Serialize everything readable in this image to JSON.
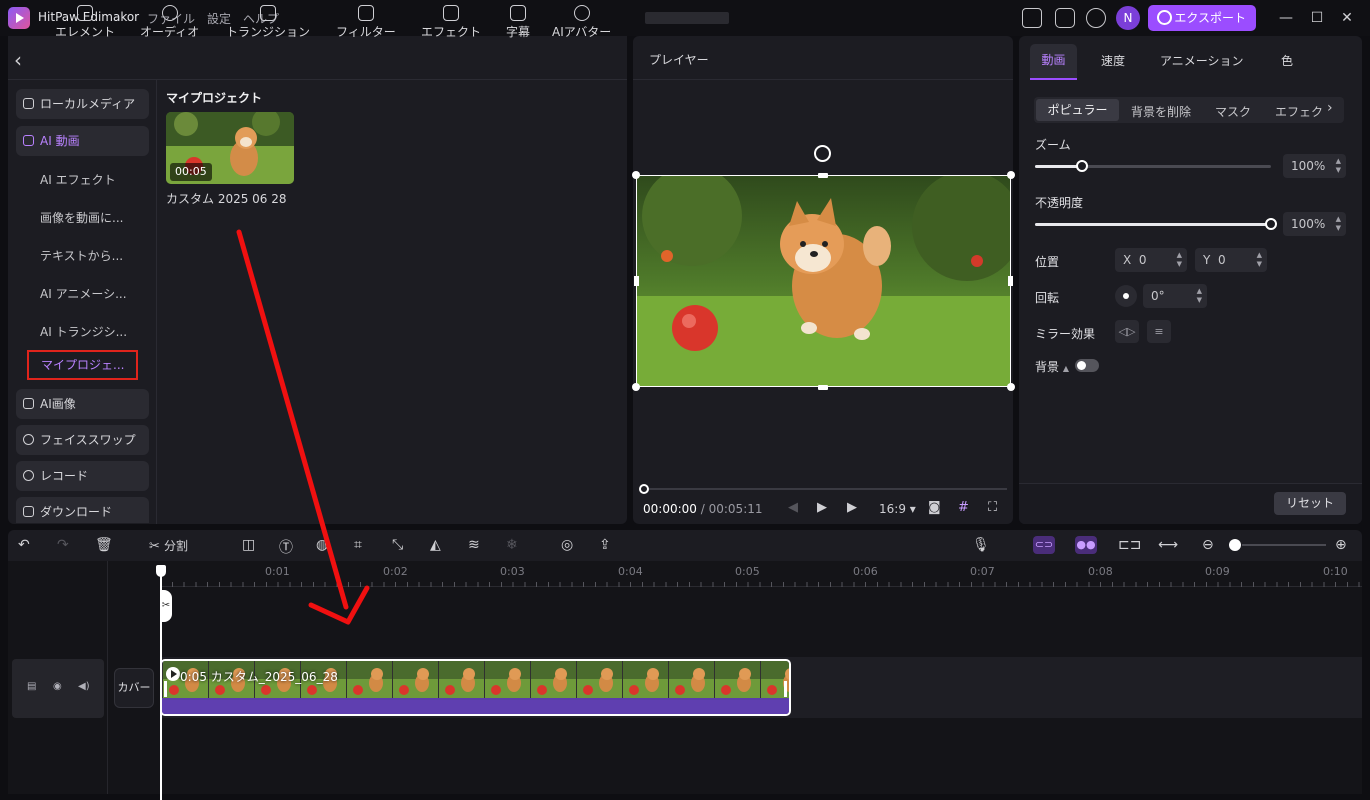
{
  "titlebar": {
    "app_name": "HitPaw Edimakor",
    "menu": [
      "ファイル",
      "設定",
      "ヘルプ"
    ],
    "project_name": "",
    "avatar_initial": "N",
    "export_label": "エクスポート"
  },
  "toolbar": {
    "tools": [
      "エレメント",
      "オーディオ",
      "トランジション",
      "フィルター",
      "エフェクト",
      "字幕",
      "AIアバター"
    ]
  },
  "sidebar": {
    "local_media": "ローカルメディア",
    "ai_video": "AI 動画",
    "subitems": [
      "AI エフェクト",
      "画像を動画に...",
      "テキストから...",
      "AI アニメーシ...",
      "AI トランジシ..."
    ],
    "selected_item": "マイプロジェ...",
    "ai_image": "AI画像",
    "face_swap": "フェイススワップ",
    "record": "レコード",
    "download": "ダウンロード"
  },
  "media": {
    "section_title": "マイプロジェクト",
    "item": {
      "duration": "00:05",
      "name": "カスタム 2025 06 28"
    }
  },
  "player": {
    "title": "プレイヤー",
    "current_time": "00:00:00",
    "separator": "/",
    "total_time": "00:05:11",
    "aspect_ratio": "16:9"
  },
  "properties": {
    "tabs": [
      "動画",
      "速度",
      "アニメーション",
      "色"
    ],
    "subtabs": [
      "ポピュラー",
      "背景を削除",
      "マスク",
      "エフェク"
    ],
    "zoom_label": "ズーム",
    "zoom_value": "100%",
    "zoom_level": 0.2,
    "opacity_label": "不透明度",
    "opacity_value": "100%",
    "opacity_level": 1.0,
    "position_label": "位置",
    "x_label": "X",
    "x_value": "0",
    "y_label": "Y",
    "y_value": "0",
    "rotation_label": "回転",
    "rotation_value": "0°",
    "mirror_label": "ミラー効果",
    "background_label": "背景",
    "reset_label": "リセット"
  },
  "edit_toolbar": {
    "split_label": "分割"
  },
  "timeline": {
    "ruler_labels": [
      "0:01",
      "0:02",
      "0:03",
      "0:04",
      "0:05",
      "0:06",
      "0:07",
      "0:08",
      "0:09",
      "0:10"
    ],
    "cover_label": "カバー",
    "clip_label": "0:05 カスタム_2025_06_28"
  },
  "colors": {
    "accent": "#9b4dff",
    "annotation": "#e0241c"
  }
}
